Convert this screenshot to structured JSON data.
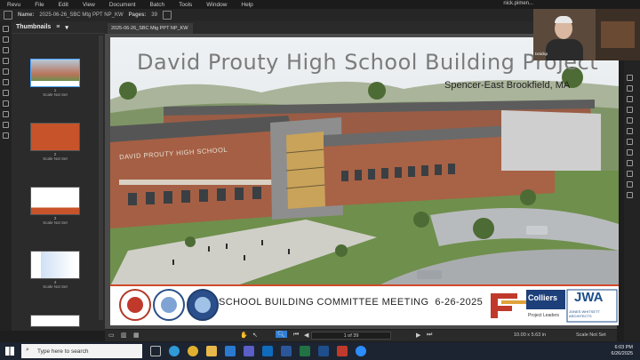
{
  "menu": [
    "Revu",
    "File",
    "Edit",
    "View",
    "Document",
    "Batch",
    "Tools",
    "Window",
    "Help"
  ],
  "user_name": "nick.pimen...",
  "toolbar": {
    "name_label": "Name:",
    "file_name": "2025-06-26_SBC Mtg PPT NP_KW",
    "pages_label": "Pages:",
    "pages_value": "39"
  },
  "thumbnails_panel": {
    "title": "Thumbnails",
    "items": [
      {
        "num": "1",
        "scale": "Scale Not Set"
      },
      {
        "num": "2",
        "scale": "Scale Not Set"
      },
      {
        "num": "3",
        "scale": "Scale Not Set"
      },
      {
        "num": "4",
        "scale": "Scale Not Set"
      }
    ]
  },
  "document_tab": "2025-06-26_SBC Mtg PPT NP_KW",
  "slide": {
    "title": "David Prouty High School Building Project",
    "subtitle": "Spencer-East Brookfield, MA",
    "building_sign": "DAVID PROUTY HIGH SCHOOL",
    "meeting": "SCHOOL BUILDING COMMITTEE MEETING  6-26-2025",
    "colliers": "Colliers",
    "colliers_sub": "Project Leaders",
    "jwa": "JWA",
    "jwa_sub": "JONES WHITSETT ARCHITECTS"
  },
  "bottom": {
    "page_indicator": "1 of 39",
    "page_size": "10.00 x 5.63 in",
    "scale": "Scale Not Set"
  },
  "webcam": {
    "label": "Ixnickp"
  },
  "taskbar": {
    "search_placeholder": "Type here to search",
    "time": "6:03 PM",
    "date": "6/26/2025"
  },
  "colors": {
    "accent": "#2f7fd6",
    "banner_red": "#c0392b",
    "jwa_blue": "#1e4e8c"
  }
}
